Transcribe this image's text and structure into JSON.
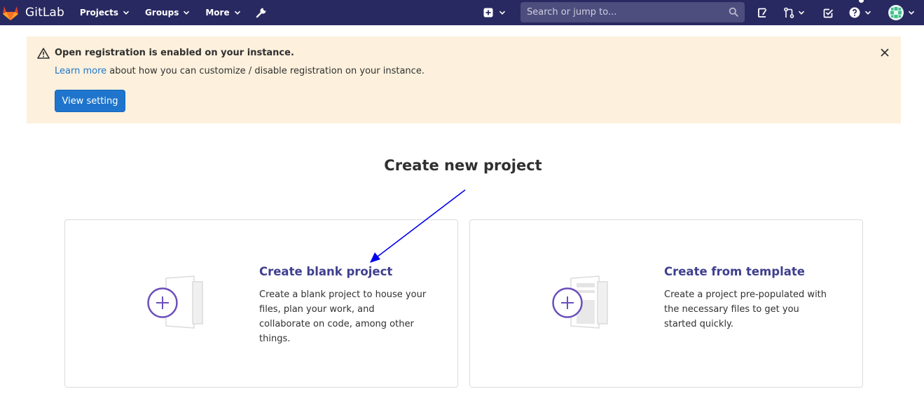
{
  "navbar": {
    "brand": "GitLab",
    "menu": [
      {
        "label": "Projects"
      },
      {
        "label": "Groups"
      },
      {
        "label": "More"
      }
    ],
    "search_placeholder": "Search or jump to...",
    "icons": [
      "wrench-icon",
      "plus-square-icon",
      "search-icon",
      "issues-icon",
      "merge-request-icon",
      "todo-icon",
      "help-icon",
      "avatar"
    ]
  },
  "alert": {
    "title": "Open registration is enabled on your instance.",
    "link_text": "Learn more",
    "body_rest": " about how you can customize / disable registration on your instance.",
    "button_label": "View setting"
  },
  "main": {
    "title": "Create new project",
    "cards": [
      {
        "title": "Create blank project",
        "description": "Create a blank project to house your files, plan your work, and collaborate on code, among other things."
      },
      {
        "title": "Create from template",
        "description": "Create a project pre-populated with the necessary files to get you started quickly."
      }
    ]
  },
  "colors": {
    "navbar": "#292961",
    "alert_bg": "#fdf1dd",
    "primary_button": "#1f75cb",
    "link": "#1f75cb",
    "card_title": "#3f3f8f",
    "illustration_accent": "#6b4fbb",
    "annotation_arrow": "#0000ee"
  }
}
